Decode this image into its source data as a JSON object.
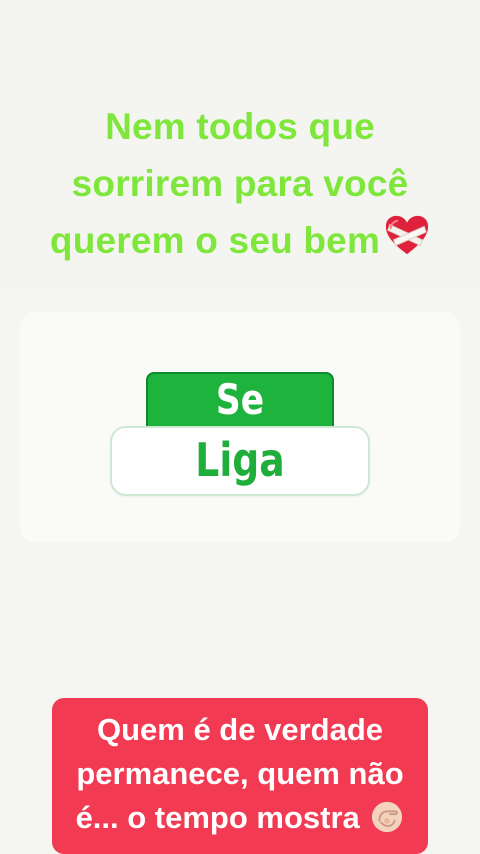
{
  "header": {
    "lines": [
      "Nem todos que",
      "sorrirem para você",
      "querem o seu bem"
    ],
    "emoji_icon": "bandaged-heart-icon",
    "color": "#7fe63c"
  },
  "logo": {
    "top_text": "Se",
    "bottom_text": "Liga",
    "accent": "#1db33c"
  },
  "footer": {
    "lines": [
      "Quem é de verdade",
      "permanece, quem não",
      "é... o tempo mostra"
    ],
    "emoji_icon": "pointing-finger-icon",
    "background": "#f23b52"
  }
}
